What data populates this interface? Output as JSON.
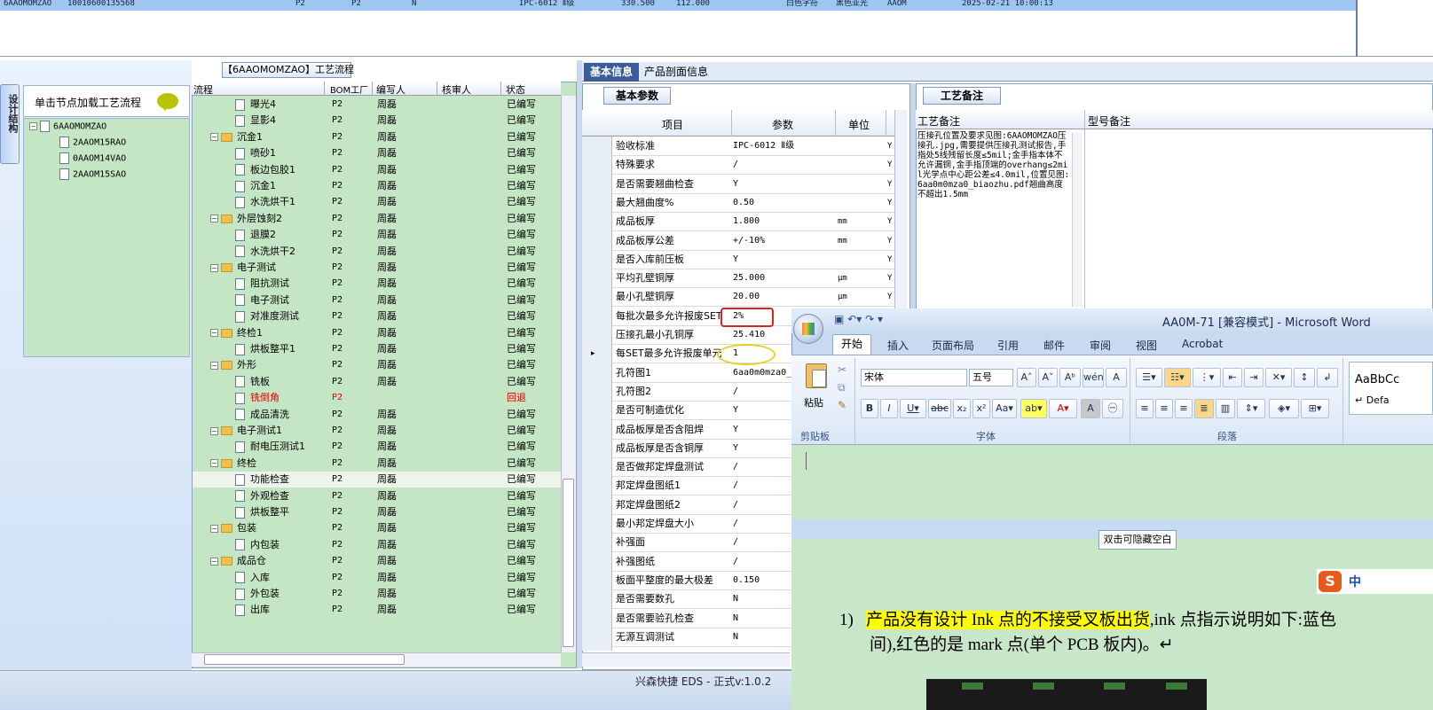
{
  "top_grid": {
    "row": [
      "6AAOMOMZAO",
      "10010600135568",
      "P2",
      "P2",
      "N",
      "IPC-6012 Ⅱ级",
      "330.500",
      "112.000",
      "白色字符",
      "黑色亚光",
      "AAOM",
      "2025-02-21 10:00:13"
    ]
  },
  "left_panel": {
    "vertical_tab": "设计结构",
    "title": "单击节点加载工艺流程",
    "tree": {
      "root": "6AAOMOMZAO",
      "children": [
        "2AAOM15RAO",
        "0AAOM14VAO",
        "2AAOM15SAO"
      ]
    }
  },
  "process": {
    "title": "【6AAOMOMZAO】工艺流程",
    "headers": [
      "流程",
      "BOM工厂",
      "编写人",
      "核审人",
      "状态"
    ],
    "rows": [
      {
        "name": "曝光4",
        "level": 2,
        "bom": "P2",
        "writer": "周磊",
        "status": "已编写"
      },
      {
        "name": "显影4",
        "level": 2,
        "bom": "P2",
        "writer": "周磊",
        "status": "已编写"
      },
      {
        "name": "沉金1",
        "level": 1,
        "bom": "P2",
        "writer": "周磊",
        "status": "已编写"
      },
      {
        "name": "喷砂1",
        "level": 2,
        "bom": "P2",
        "writer": "周磊",
        "status": "已编写"
      },
      {
        "name": "板边包胶1",
        "level": 2,
        "bom": "P2",
        "writer": "周磊",
        "status": "已编写"
      },
      {
        "name": "沉金1",
        "level": 2,
        "bom": "P2",
        "writer": "周磊",
        "status": "已编写"
      },
      {
        "name": "水洗烘干1",
        "level": 2,
        "bom": "P2",
        "writer": "周磊",
        "status": "已编写"
      },
      {
        "name": "外层蚀刻2",
        "level": 1,
        "bom": "P2",
        "writer": "周磊",
        "status": "已编写"
      },
      {
        "name": "退膜2",
        "level": 2,
        "bom": "P2",
        "writer": "周磊",
        "status": "已编写"
      },
      {
        "name": "水洗烘干2",
        "level": 2,
        "bom": "P2",
        "writer": "周磊",
        "status": "已编写"
      },
      {
        "name": "电子测试",
        "level": 1,
        "bom": "P2",
        "writer": "周磊",
        "status": "已编写"
      },
      {
        "name": "阻抗测试",
        "level": 2,
        "bom": "P2",
        "writer": "周磊",
        "status": "已编写"
      },
      {
        "name": "电子测试",
        "level": 2,
        "bom": "P2",
        "writer": "周磊",
        "status": "已编写"
      },
      {
        "name": "对准度测试",
        "level": 2,
        "bom": "P2",
        "writer": "周磊",
        "status": "已编写"
      },
      {
        "name": "终检1",
        "level": 1,
        "bom": "P2",
        "writer": "周磊",
        "status": "已编写"
      },
      {
        "name": "烘板整平1",
        "level": 2,
        "bom": "P2",
        "writer": "周磊",
        "status": "已编写"
      },
      {
        "name": "外形",
        "level": 1,
        "bom": "P2",
        "writer": "周磊",
        "status": "已编写"
      },
      {
        "name": "铣板",
        "level": 2,
        "bom": "P2",
        "writer": "周磊",
        "status": "已编写"
      },
      {
        "name": "铣倒角",
        "level": 2,
        "bom": "P2",
        "writer": "",
        "status": "回退",
        "red": true
      },
      {
        "name": "成品清洗",
        "level": 2,
        "bom": "P2",
        "writer": "周磊",
        "status": "已编写"
      },
      {
        "name": "电子测试1",
        "level": 1,
        "bom": "P2",
        "writer": "周磊",
        "status": "已编写"
      },
      {
        "name": "耐电压测试1",
        "level": 2,
        "bom": "P2",
        "writer": "周磊",
        "status": "已编写"
      },
      {
        "name": "终检",
        "level": 1,
        "bom": "P2",
        "writer": "周磊",
        "status": "已编写"
      },
      {
        "name": "功能检查",
        "level": 2,
        "bom": "P2",
        "writer": "周磊",
        "status": "已编写",
        "selected": true
      },
      {
        "name": "外观检查",
        "level": 2,
        "bom": "P2",
        "writer": "周磊",
        "status": "已编写"
      },
      {
        "name": "烘板整平",
        "level": 2,
        "bom": "P2",
        "writer": "周磊",
        "status": "已编写"
      },
      {
        "name": "包装",
        "level": 1,
        "bom": "P2",
        "writer": "周磊",
        "status": "已编写"
      },
      {
        "name": "内包装",
        "level": 2,
        "bom": "P2",
        "writer": "周磊",
        "status": "已编写"
      },
      {
        "name": "成品仓",
        "level": 1,
        "bom": "P2",
        "writer": "周磊",
        "status": "已编写"
      },
      {
        "name": "入库",
        "level": 2,
        "bom": "P2",
        "writer": "周磊",
        "status": "已编写"
      },
      {
        "name": "外包装",
        "level": 2,
        "bom": "P2",
        "writer": "周磊",
        "status": "已编写"
      },
      {
        "name": "出库",
        "level": 2,
        "bom": "P2",
        "writer": "周磊",
        "status": "已编写"
      }
    ]
  },
  "tabs": {
    "basic": "基本信息",
    "product": "产品剖面信息"
  },
  "params": {
    "tab": "基本参数",
    "headers": [
      "项目",
      "参数",
      "单位"
    ],
    "rows": [
      {
        "k": "验收标准",
        "v": "IPC-6012 Ⅱ级",
        "u": "",
        "y": "Y"
      },
      {
        "k": "特殊要求",
        "v": "/",
        "u": "",
        "y": "Y"
      },
      {
        "k": "是否需要翘曲检查",
        "v": "Y",
        "u": "",
        "y": "Y"
      },
      {
        "k": "最大翘曲度%",
        "v": "0.50",
        "u": "",
        "y": "Y"
      },
      {
        "k": "成品板厚",
        "v": "1.800",
        "u": "mm",
        "y": "Y"
      },
      {
        "k": "成品板厚公差",
        "v": "+/-10%",
        "u": "mm",
        "y": "Y"
      },
      {
        "k": "是否入库前压板",
        "v": "Y",
        "u": "",
        "y": "Y"
      },
      {
        "k": "平均孔壁铜厚",
        "v": "25.000",
        "u": "μm",
        "y": "Y"
      },
      {
        "k": "最小孔壁铜厚",
        "v": "20.00",
        "u": "μm",
        "y": "Y"
      },
      {
        "k": "每批次最多允许报废SET",
        "v": "2%",
        "u": "",
        "y": ""
      },
      {
        "k": "压接孔最小孔铜厚",
        "v": "25.410",
        "u": "",
        "y": ""
      },
      {
        "k": "每SET最多允许报废单元",
        "v": "1",
        "u": "",
        "y": ""
      },
      {
        "k": "孔符图1",
        "v": "6aa0m0mza0_",
        "u": "",
        "y": ""
      },
      {
        "k": "孔符图2",
        "v": "/",
        "u": "",
        "y": ""
      },
      {
        "k": "是否可制造优化",
        "v": "Y",
        "u": "",
        "y": ""
      },
      {
        "k": "成品板厚是否含阻焊",
        "v": "Y",
        "u": "",
        "y": ""
      },
      {
        "k": "成品板厚是否含铜厚",
        "v": "Y",
        "u": "",
        "y": ""
      },
      {
        "k": "是否做邦定焊盘测试",
        "v": "/",
        "u": "",
        "y": ""
      },
      {
        "k": "邦定焊盘图纸1",
        "v": "/",
        "u": "",
        "y": ""
      },
      {
        "k": "邦定焊盘图纸2",
        "v": "/",
        "u": "",
        "y": ""
      },
      {
        "k": "最小邦定焊盘大小",
        "v": "/",
        "u": "",
        "y": ""
      },
      {
        "k": "补强面",
        "v": "/",
        "u": "",
        "y": ""
      },
      {
        "k": "补强图纸",
        "v": "/",
        "u": "",
        "y": ""
      },
      {
        "k": "板面平整度的最大极差",
        "v": "0.150",
        "u": "",
        "y": ""
      },
      {
        "k": "是否需要数孔",
        "v": "N",
        "u": "",
        "y": ""
      },
      {
        "k": "是否需要验孔检查",
        "v": "N",
        "u": "",
        "y": ""
      },
      {
        "k": "无源互调测试",
        "v": "N",
        "u": "",
        "y": ""
      }
    ]
  },
  "notes": {
    "tab": "工艺备注",
    "col1": "工艺备注",
    "col2": "型号备注",
    "text": "压接孔位置及要求见图:6AAOMOMZAO压接孔.jpg,需要提供压接孔测试报告,手指处5线残留长度≤5mil;金手指本体不允许漏铜,金手指顶端的overhang≤2mil光学点中心距公差≤4.0mil,位置见图:6aa0m0mza0_biaozhu.pdf翘曲高度不超出1.5mm"
  },
  "status": {
    "text": "兴森快捷 EDS - 正式v:1.0.2"
  },
  "word": {
    "title": "AA0M-71 [兼容模式] - Microsoft Word",
    "tabs": [
      "开始",
      "插入",
      "页面布局",
      "引用",
      "邮件",
      "审阅",
      "视图",
      "Acrobat"
    ],
    "font": "宋体",
    "size": "五号",
    "groups": [
      "剪贴板",
      "字体",
      "段落"
    ],
    "paste": "粘贴",
    "style_preview": "AaBbCc",
    "style_name": "↵ Defa",
    "hide_blank": "双击可隐藏空白",
    "ime": "中",
    "line1_num": "1)",
    "line1_hl": "产品没有设计 Ink 点的不接受叉板出货",
    "line1_rest": ",ink 点指示说明如下:蓝色",
    "line2": "间),红色的是 mark 点(单个 PCB 板内)。↵"
  }
}
